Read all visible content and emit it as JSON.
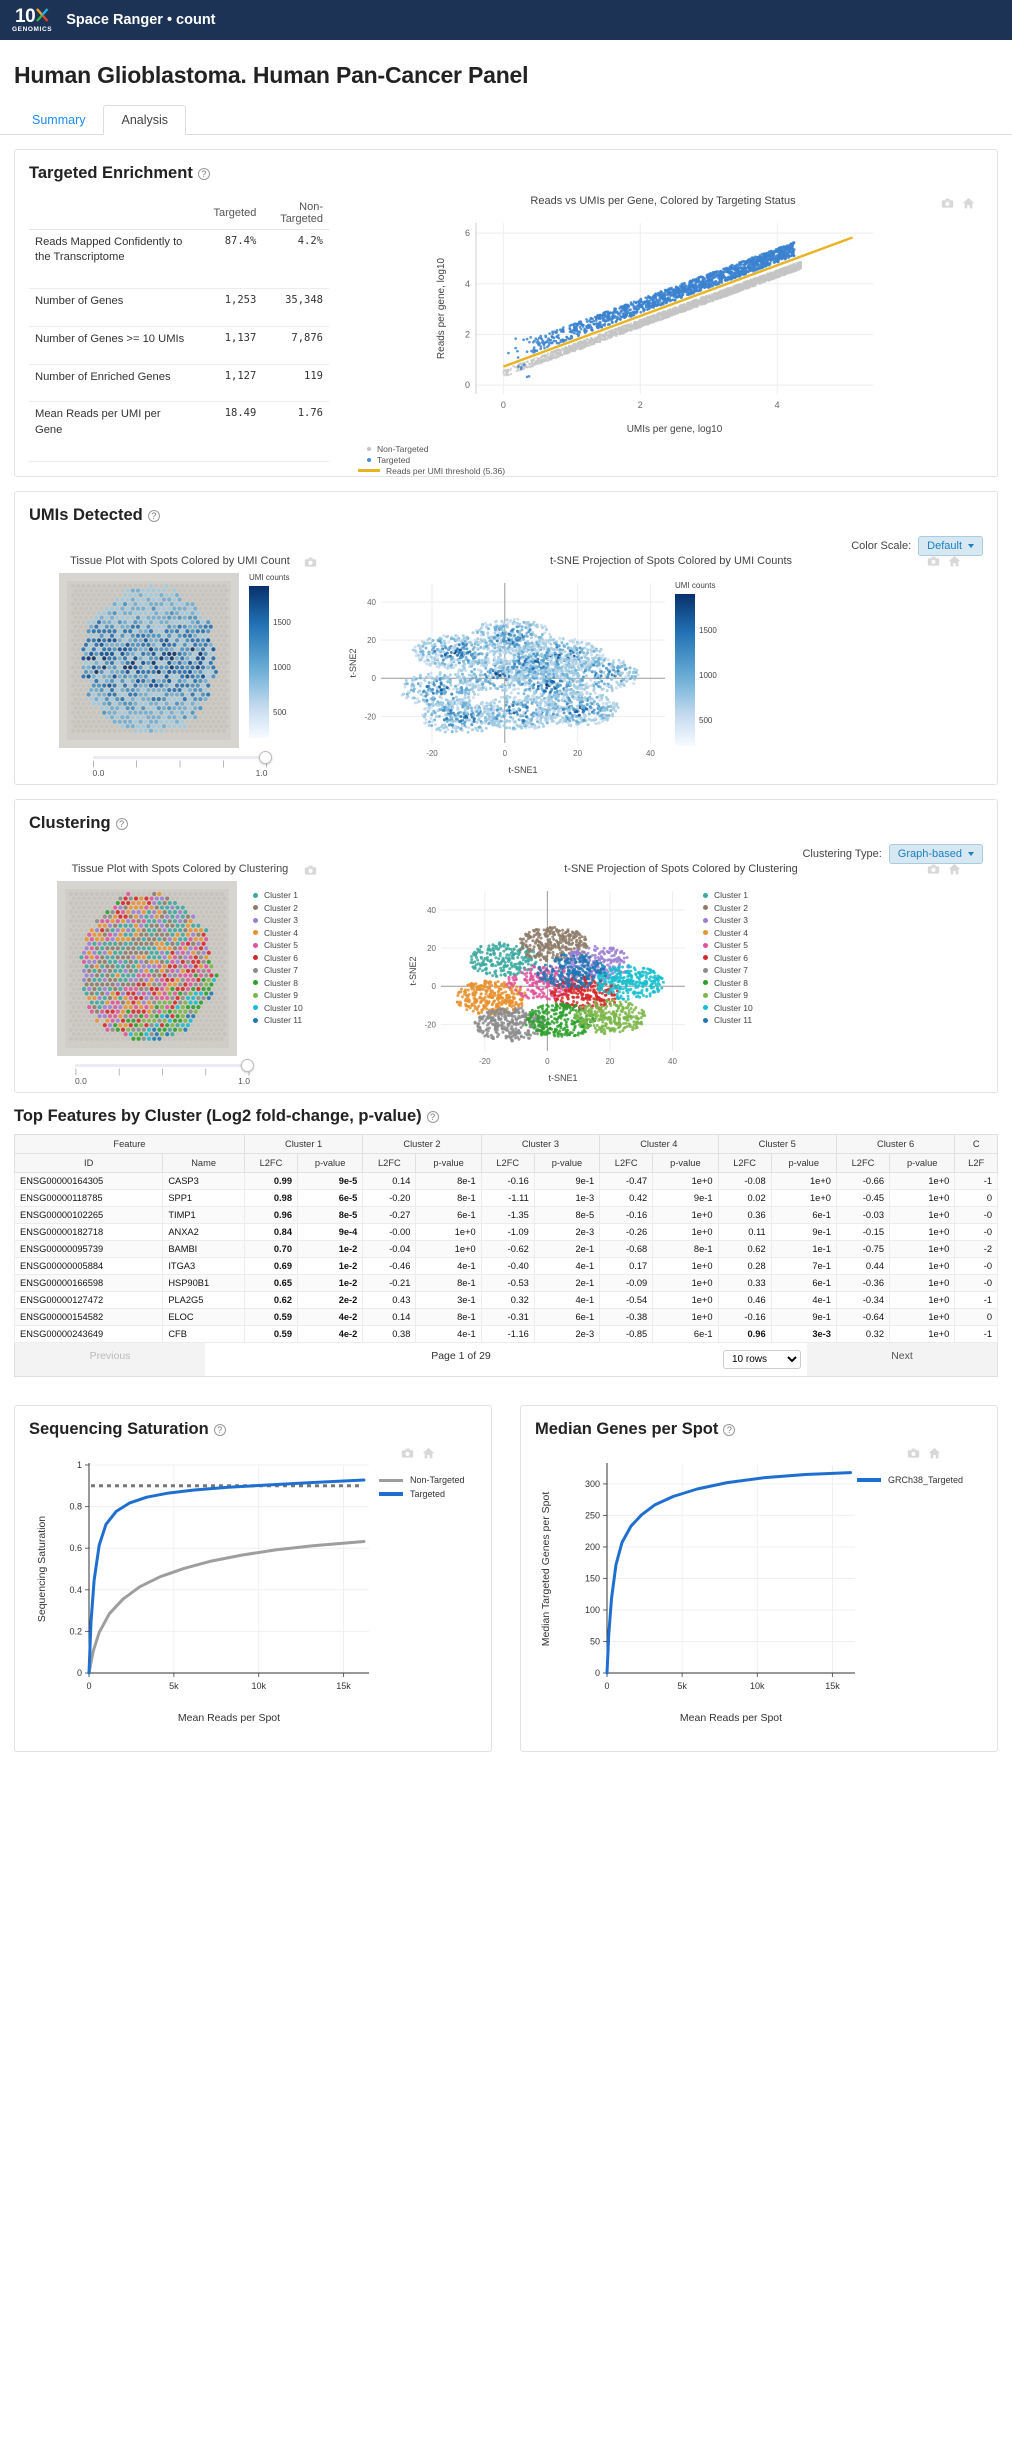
{
  "navbar": {
    "brand_top": "10",
    "brand_bottom": "GENOMICS",
    "title": "Space Ranger • count"
  },
  "page": {
    "title": "Human Glioblastoma. Human Pan-Cancer Panel"
  },
  "tabs": [
    {
      "label": "Summary",
      "active": false
    },
    {
      "label": "Analysis",
      "active": true
    }
  ],
  "targeted_enrichment": {
    "title": "Targeted Enrichment",
    "help": "?",
    "columns": [
      "",
      "Targeted",
      "Non-Targeted"
    ],
    "rows": [
      {
        "name": "Reads Mapped Confidently to the Transcriptome",
        "targeted": "87.4%",
        "non_targeted": "4.2%"
      },
      {
        "name": "Number of Genes",
        "targeted": "1,253",
        "non_targeted": "35,348"
      },
      {
        "name": "Number of Genes >= 10 UMIs",
        "targeted": "1,137",
        "non_targeted": "7,876"
      },
      {
        "name": "Number of Enriched Genes",
        "targeted": "1,127",
        "non_targeted": "119"
      },
      {
        "name": "Mean Reads per UMI per Gene",
        "targeted": "18.49",
        "non_targeted": "1.76"
      }
    ],
    "chart_data": {
      "type": "scatter",
      "title": "Reads vs UMIs per Gene, Colored by Targeting Status",
      "xlabel": "UMIs per gene, log10",
      "ylabel": "Reads per gene, log10",
      "xlim": [
        -0.4,
        5.4
      ],
      "ylim": [
        -0.35,
        6.4
      ],
      "xticks": [
        "0",
        "2",
        "4"
      ],
      "xtickvals": [
        0,
        2,
        4
      ],
      "yticks": [
        "0",
        "2",
        "4",
        "6"
      ],
      "ytickvals": [
        0,
        2,
        4,
        6
      ],
      "grid": true,
      "legend": [
        {
          "label": "Non-Targeted",
          "marker": "dot",
          "color": "#c4c4c4"
        },
        {
          "label": "Targeted",
          "marker": "dot",
          "color": "#4a90d9"
        },
        {
          "label": "Reads per UMI threshold (5.36)",
          "marker": "line",
          "color": "#e8b424"
        }
      ],
      "threshold_line": {
        "slope": 1.0,
        "intercept": 0.73,
        "label": "Reads per UMI threshold (5.36)"
      }
    }
  },
  "umis_detected": {
    "title": "UMIs Detected",
    "help": "?",
    "control_label": "Color Scale:",
    "control_value": "Default",
    "tissue_plot": {
      "title": "Tissue Plot with Spots Colored by UMI Count",
      "colorbar_title": "UMI counts",
      "colorbar_ticks": [
        "1500",
        "1000",
        "500"
      ]
    },
    "tsne_plot": {
      "title": "t-SNE Projection of Spots Colored by UMI Counts",
      "xlabel": "t-SNE1",
      "ylabel": "t-SNE2",
      "xticks": [
        "-20",
        "0",
        "20",
        "40"
      ],
      "yticks": [
        "40",
        "20",
        "0",
        "-20"
      ],
      "colorbar_title": "UMI counts",
      "colorbar_ticks": [
        "1500",
        "1000",
        "500"
      ]
    },
    "slider": {
      "min": "0.0",
      "max": "1.0"
    }
  },
  "clustering": {
    "title": "Clustering",
    "help": "?",
    "control_label": "Clustering Type:",
    "control_value": "Graph-based",
    "tissue_plot": {
      "title": "Tissue Plot with Spots Colored by Clustering"
    },
    "tsne_plot": {
      "title": "t-SNE Projection of Spots Colored by Clustering",
      "xlabel": "t-SNE1",
      "ylabel": "t-SNE2",
      "xticks": [
        "-20",
        "0",
        "20",
        "40"
      ],
      "yticks": [
        "40",
        "20",
        "0",
        "-20"
      ]
    },
    "slider": {
      "min": "0.0",
      "max": "1.0"
    },
    "legend": [
      {
        "label": "Cluster 1",
        "color": "#3ba9a0"
      },
      {
        "label": "Cluster 2",
        "color": "#8d7b68"
      },
      {
        "label": "Cluster 3",
        "color": "#9b7fd4"
      },
      {
        "label": "Cluster 4",
        "color": "#e8922f"
      },
      {
        "label": "Cluster 5",
        "color": "#e0539b"
      },
      {
        "label": "Cluster 6",
        "color": "#d62728"
      },
      {
        "label": "Cluster 7",
        "color": "#8c8c8c"
      },
      {
        "label": "Cluster 8",
        "color": "#2ca02c"
      },
      {
        "label": "Cluster 9",
        "color": "#7ab648"
      },
      {
        "label": "Cluster 10",
        "color": "#17becf"
      },
      {
        "label": "Cluster 11",
        "color": "#1f77b4"
      }
    ]
  },
  "top_features": {
    "title": "Top Features by Cluster (Log2 fold-change, p-value)",
    "help": "?",
    "group_headers": [
      "Feature",
      "Cluster 1",
      "Cluster 2",
      "Cluster 3",
      "Cluster 4",
      "Cluster 5",
      "Cluster 6",
      "C"
    ],
    "sub_headers": [
      "ID",
      "Name",
      "L2FC",
      "p-value",
      "L2FC",
      "p-value",
      "L2FC",
      "p-value",
      "L2FC",
      "p-value",
      "L2FC",
      "p-value",
      "L2FC",
      "p-value",
      "L2F"
    ],
    "rows": [
      {
        "id": "ENSG00000164305",
        "name": "CASP3",
        "cells": [
          [
            "0.99",
            1
          ],
          [
            "9e-5",
            1
          ],
          [
            "0.14",
            0
          ],
          [
            "8e-1",
            0
          ],
          [
            "-0.16",
            0
          ],
          [
            "9e-1",
            0
          ],
          [
            "-0.47",
            0
          ],
          [
            "1e+0",
            0
          ],
          [
            "-0.08",
            0
          ],
          [
            "1e+0",
            0
          ],
          [
            "-0.66",
            0
          ],
          [
            "1e+0",
            0
          ],
          [
            "-1",
            0
          ]
        ]
      },
      {
        "id": "ENSG00000118785",
        "name": "SPP1",
        "cells": [
          [
            "0.98",
            1
          ],
          [
            "6e-5",
            1
          ],
          [
            "-0.20",
            0
          ],
          [
            "8e-1",
            0
          ],
          [
            "-1.11",
            0
          ],
          [
            "1e-3",
            0
          ],
          [
            "0.42",
            0
          ],
          [
            "9e-1",
            0
          ],
          [
            "0.02",
            0
          ],
          [
            "1e+0",
            0
          ],
          [
            "-0.45",
            0
          ],
          [
            "1e+0",
            0
          ],
          [
            "0",
            0
          ]
        ]
      },
      {
        "id": "ENSG00000102265",
        "name": "TIMP1",
        "cells": [
          [
            "0.96",
            1
          ],
          [
            "8e-5",
            1
          ],
          [
            "-0.27",
            0
          ],
          [
            "6e-1",
            0
          ],
          [
            "-1.35",
            0
          ],
          [
            "8e-5",
            0
          ],
          [
            "-0.16",
            0
          ],
          [
            "1e+0",
            0
          ],
          [
            "0.36",
            0
          ],
          [
            "6e-1",
            0
          ],
          [
            "-0.03",
            0
          ],
          [
            "1e+0",
            0
          ],
          [
            "-0",
            0
          ]
        ]
      },
      {
        "id": "ENSG00000182718",
        "name": "ANXA2",
        "cells": [
          [
            "0.84",
            1
          ],
          [
            "9e-4",
            1
          ],
          [
            "-0.00",
            0
          ],
          [
            "1e+0",
            0
          ],
          [
            "-1.09",
            0
          ],
          [
            "2e-3",
            0
          ],
          [
            "-0.26",
            0
          ],
          [
            "1e+0",
            0
          ],
          [
            "0.11",
            0
          ],
          [
            "9e-1",
            0
          ],
          [
            "-0.15",
            0
          ],
          [
            "1e+0",
            0
          ],
          [
            "-0",
            0
          ]
        ]
      },
      {
        "id": "ENSG00000095739",
        "name": "BAMBI",
        "cells": [
          [
            "0.70",
            1
          ],
          [
            "1e-2",
            1
          ],
          [
            "-0.04",
            0
          ],
          [
            "1e+0",
            0
          ],
          [
            "-0.62",
            0
          ],
          [
            "2e-1",
            0
          ],
          [
            "-0.68",
            0
          ],
          [
            "8e-1",
            0
          ],
          [
            "0.62",
            0
          ],
          [
            "1e-1",
            0
          ],
          [
            "-0.75",
            0
          ],
          [
            "1e+0",
            0
          ],
          [
            "-2",
            0
          ]
        ]
      },
      {
        "id": "ENSG00000005884",
        "name": "ITGA3",
        "cells": [
          [
            "0.69",
            1
          ],
          [
            "1e-2",
            1
          ],
          [
            "-0.46",
            0
          ],
          [
            "4e-1",
            0
          ],
          [
            "-0.40",
            0
          ],
          [
            "4e-1",
            0
          ],
          [
            "0.17",
            0
          ],
          [
            "1e+0",
            0
          ],
          [
            "0.28",
            0
          ],
          [
            "7e-1",
            0
          ],
          [
            "0.44",
            0
          ],
          [
            "1e+0",
            0
          ],
          [
            "-0",
            0
          ]
        ]
      },
      {
        "id": "ENSG00000166598",
        "name": "HSP90B1",
        "cells": [
          [
            "0.65",
            1
          ],
          [
            "1e-2",
            1
          ],
          [
            "-0.21",
            0
          ],
          [
            "8e-1",
            0
          ],
          [
            "-0.53",
            0
          ],
          [
            "2e-1",
            0
          ],
          [
            "-0.09",
            0
          ],
          [
            "1e+0",
            0
          ],
          [
            "0.33",
            0
          ],
          [
            "6e-1",
            0
          ],
          [
            "-0.36",
            0
          ],
          [
            "1e+0",
            0
          ],
          [
            "-0",
            0
          ]
        ]
      },
      {
        "id": "ENSG00000127472",
        "name": "PLA2G5",
        "cells": [
          [
            "0.62",
            1
          ],
          [
            "2e-2",
            1
          ],
          [
            "0.43",
            0
          ],
          [
            "3e-1",
            0
          ],
          [
            "0.32",
            0
          ],
          [
            "4e-1",
            0
          ],
          [
            "-0.54",
            0
          ],
          [
            "1e+0",
            0
          ],
          [
            "0.46",
            0
          ],
          [
            "4e-1",
            0
          ],
          [
            "-0.34",
            0
          ],
          [
            "1e+0",
            0
          ],
          [
            "-1",
            0
          ]
        ]
      },
      {
        "id": "ENSG00000154582",
        "name": "ELOC",
        "cells": [
          [
            "0.59",
            1
          ],
          [
            "4e-2",
            1
          ],
          [
            "0.14",
            0
          ],
          [
            "8e-1",
            0
          ],
          [
            "-0.31",
            0
          ],
          [
            "6e-1",
            0
          ],
          [
            "-0.38",
            0
          ],
          [
            "1e+0",
            0
          ],
          [
            "-0.16",
            0
          ],
          [
            "9e-1",
            0
          ],
          [
            "-0.64",
            0
          ],
          [
            "1e+0",
            0
          ],
          [
            "0",
            0
          ]
        ]
      },
      {
        "id": "ENSG00000243649",
        "name": "CFB",
        "cells": [
          [
            "0.59",
            1
          ],
          [
            "4e-2",
            1
          ],
          [
            "0.38",
            0
          ],
          [
            "4e-1",
            0
          ],
          [
            "-1.16",
            0
          ],
          [
            "2e-3",
            0
          ],
          [
            "-0.85",
            0
          ],
          [
            "6e-1",
            0
          ],
          [
            "0.96",
            1
          ],
          [
            "3e-3",
            1
          ],
          [
            "0.32",
            0
          ],
          [
            "1e+0",
            0
          ],
          [
            "-1",
            0
          ]
        ]
      }
    ],
    "pager": {
      "previous": "Previous",
      "page_info": "Page 1 of 29",
      "rows_per_page": "10 rows",
      "next": "Next"
    }
  },
  "sequencing_saturation": {
    "title": "Sequencing Saturation",
    "help": "?",
    "chart_data": {
      "type": "line",
      "xlabel": "Mean Reads per Spot",
      "ylabel": "Sequencing Saturation",
      "xticks": [
        "0",
        "5k",
        "10k",
        "15k"
      ],
      "xtickvals": [
        0,
        5000,
        10000,
        15000
      ],
      "yticks": [
        "0",
        "0.2",
        "0.4",
        "0.6",
        "0.8",
        "1"
      ],
      "ytickvals": [
        0,
        0.2,
        0.4,
        0.6,
        0.8,
        1
      ],
      "xlim": [
        0,
        16500
      ],
      "ylim": [
        0,
        1
      ],
      "grid": true,
      "reference_line": {
        "y": 0.9,
        "style": "dotted",
        "color": "#777"
      },
      "series": [
        {
          "name": "Non-Targeted",
          "color": "#9e9e9e",
          "x": [
            0,
            250,
            600,
            1200,
            2000,
            3000,
            4200,
            5600,
            7200,
            9000,
            11000,
            13200,
            16200
          ],
          "y": [
            0,
            0.105,
            0.195,
            0.285,
            0.355,
            0.415,
            0.463,
            0.503,
            0.538,
            0.567,
            0.592,
            0.612,
            0.632
          ]
        },
        {
          "name": "Targeted",
          "color": "#1f6fd0",
          "x": [
            0,
            120,
            300,
            600,
            1000,
            1600,
            2400,
            3400,
            4600,
            6200,
            8200,
            10500,
            13200,
            16200
          ],
          "y": [
            0,
            0.245,
            0.445,
            0.615,
            0.715,
            0.777,
            0.818,
            0.845,
            0.864,
            0.88,
            0.893,
            0.904,
            0.916,
            0.928
          ]
        }
      ]
    }
  },
  "median_genes": {
    "title": "Median Genes per Spot",
    "help": "?",
    "chart_data": {
      "type": "line",
      "xlabel": "Mean Reads per Spot",
      "ylabel": "Median Targeted Genes per Spot",
      "xticks": [
        "0",
        "5k",
        "10k",
        "15k"
      ],
      "xtickvals": [
        0,
        5000,
        10000,
        15000
      ],
      "yticks": [
        "0",
        "50",
        "100",
        "150",
        "200",
        "250",
        "300"
      ],
      "ytickvals": [
        0,
        50,
        100,
        150,
        200,
        250,
        300
      ],
      "xlim": [
        0,
        16500
      ],
      "ylim": [
        0,
        330
      ],
      "grid": true,
      "series": [
        {
          "name": "GRCh38_Targeted",
          "color": "#1f6fd0",
          "x": [
            0,
            120,
            300,
            600,
            1000,
            1600,
            2300,
            3200,
            4400,
            6000,
            8000,
            10500,
            13200,
            16200
          ],
          "y": [
            0,
            62,
            118,
            172,
            207,
            233,
            251,
            267,
            280,
            292,
            302,
            310,
            315,
            318
          ]
        }
      ]
    }
  },
  "icons": {
    "camera": "camera-icon",
    "home": "home-icon"
  }
}
